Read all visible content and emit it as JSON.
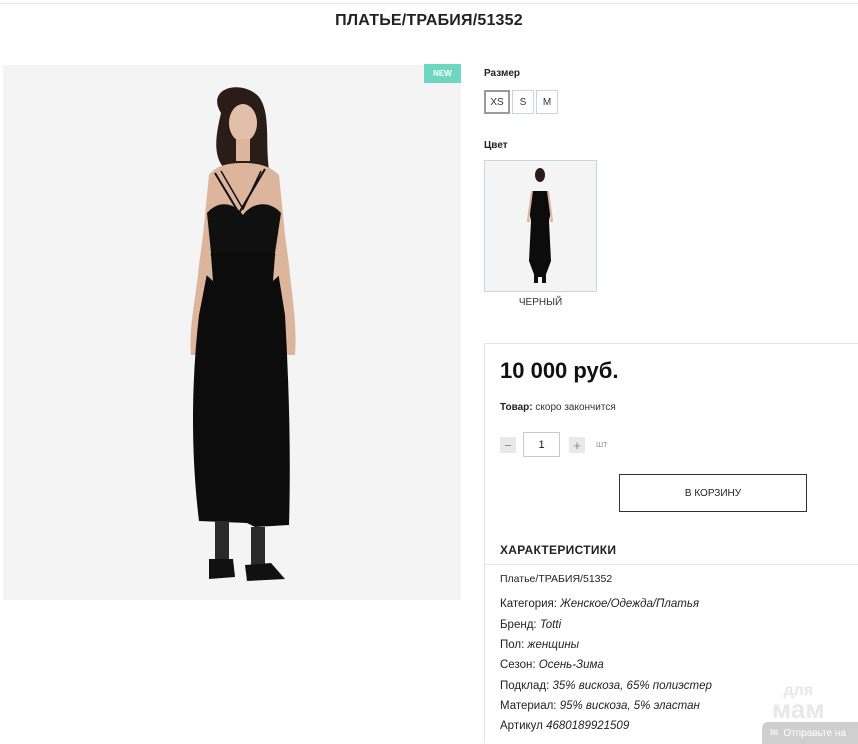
{
  "page": {
    "title": "ПЛАТЬЕ/ТРАБИЯ/51352"
  },
  "badge": {
    "text": "NEW",
    "color": "#6fd6c0"
  },
  "size": {
    "label": "Размер",
    "options": [
      "XS",
      "S",
      "M"
    ],
    "selected": "XS"
  },
  "color": {
    "label": "Цвет",
    "selected_name": "ЧЕРНЫЙ"
  },
  "buy": {
    "price": "10 000 руб.",
    "stock_label": "Товар:",
    "stock_text": "скоро закончится",
    "qty_minus": "−",
    "qty_value": "1",
    "qty_plus": "+",
    "qty_unit": "шт",
    "cart_button": "В КОРЗИНУ"
  },
  "specs": {
    "title": "ХАРАКТЕРИСТИКИ",
    "name": "Платье/ТРАБИЯ/51352",
    "rows": [
      {
        "key": "Категория:",
        "value": "Женское/Одежда/Платья"
      },
      {
        "key": "Бренд:",
        "value": "Totti"
      },
      {
        "key": "Пол:",
        "value": "женщины"
      },
      {
        "key": "Сезон:",
        "value": "Осень-Зима"
      },
      {
        "key": "Подклад:",
        "value": "35% вискоза, 65% полиэстер"
      },
      {
        "key": "Материал:",
        "value": "95% вискоза, 5% эластан"
      },
      {
        "key": "Артикул",
        "value": "4680189921509"
      }
    ]
  },
  "overlay": {
    "watermark_top": "для",
    "watermark_main": "мам",
    "send_button": "Отправьте на"
  }
}
